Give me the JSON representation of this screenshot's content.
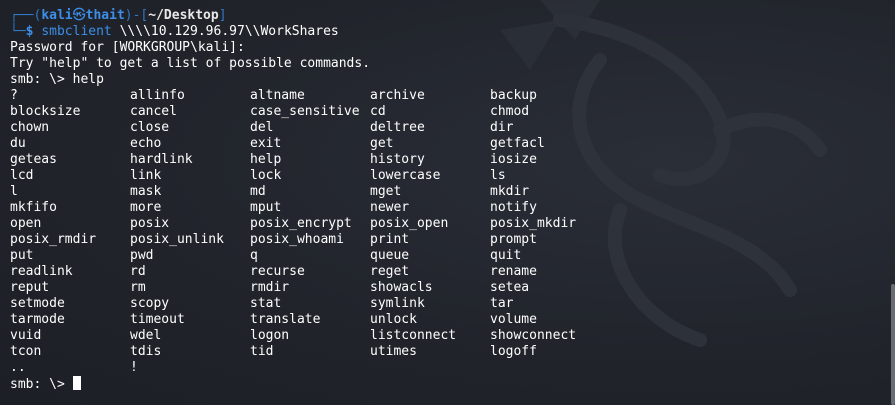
{
  "prompt": {
    "corner_top": "┌──(",
    "user": "kali",
    "at_symbol": "㉿",
    "host": "thait",
    "sep_open": ")-[",
    "dir": "~/Desktop",
    "sep_close": "]",
    "corner_bottom": "└─",
    "dollar": "$",
    "command_name": "smbclient",
    "command_args": " \\\\\\\\10.129.96.97\\\\WorkShares"
  },
  "output_lines": [
    "Password for [WORKGROUP\\kali]:",
    "Try \"help\" to get a list of possible commands.",
    "smb: \\> help"
  ],
  "help_commands": [
    "?",
    "allinfo",
    "altname",
    "archive",
    "backup",
    "blocksize",
    "cancel",
    "case_sensitive",
    "cd",
    "chmod",
    "chown",
    "close",
    "del",
    "deltree",
    "dir",
    "du",
    "echo",
    "exit",
    "get",
    "getfacl",
    "geteas",
    "hardlink",
    "help",
    "history",
    "iosize",
    "lcd",
    "link",
    "lock",
    "lowercase",
    "ls",
    "l",
    "mask",
    "md",
    "mget",
    "mkdir",
    "mkfifo",
    "more",
    "mput",
    "newer",
    "notify",
    "open",
    "posix",
    "posix_encrypt",
    "posix_open",
    "posix_mkdir",
    "posix_rmdir",
    "posix_unlink",
    "posix_whoami",
    "print",
    "prompt",
    "put",
    "pwd",
    "q",
    "queue",
    "quit",
    "readlink",
    "rd",
    "recurse",
    "reget",
    "rename",
    "reput",
    "rm",
    "rmdir",
    "showacls",
    "setea",
    "setmode",
    "scopy",
    "stat",
    "symlink",
    "tar",
    "tarmode",
    "timeout",
    "translate",
    "unlock",
    "volume",
    "vuid",
    "wdel",
    "logon",
    "listconnect",
    "showconnect",
    "tcon",
    "tdis",
    "tid",
    "utimes",
    "logoff",
    "..",
    "!"
  ],
  "final_prompt": "smb: \\> ",
  "colors": {
    "background": "#1e2127",
    "prompt_blue": "#3d8ee8",
    "text": "#ffffff"
  }
}
